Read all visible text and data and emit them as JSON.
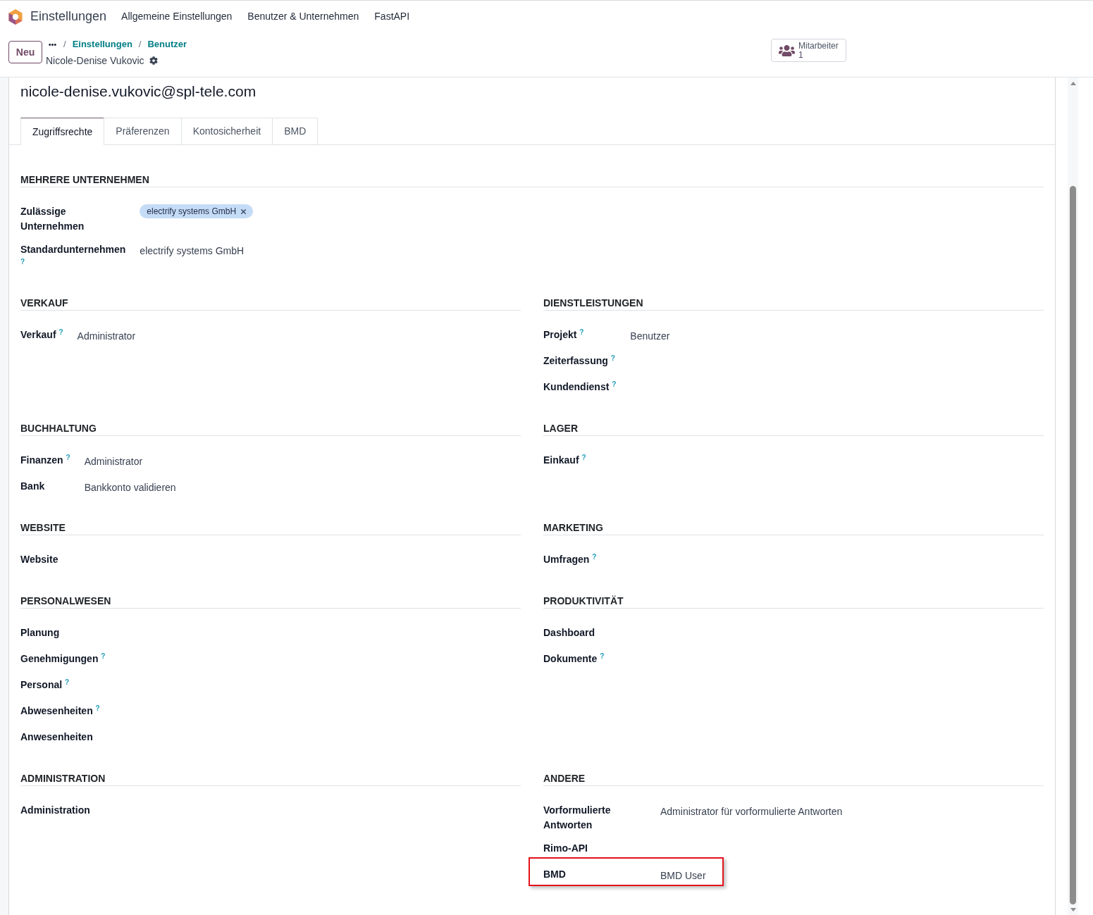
{
  "navbar": {
    "app_name": "Einstellungen",
    "menu": [
      "Allgemeine Einstellungen",
      "Benutzer & Unternehmen",
      "FastAPI"
    ]
  },
  "control_panel": {
    "new_button": "Neu",
    "breadcrumb": {
      "separator": "/",
      "items": [
        "Einstellungen",
        "Benutzer"
      ]
    },
    "record_name": "Nicole-Denise Vukovic",
    "stat_button": {
      "label": "Mitarbeiter",
      "value": "1"
    }
  },
  "form": {
    "title": "nicole-denise.vukovic@spl-tele.com",
    "tabs": [
      {
        "label": "Zugriffsrechte",
        "selected": true
      },
      {
        "label": "Präferenzen",
        "selected": false
      },
      {
        "label": "Kontosicherheit",
        "selected": false
      },
      {
        "label": "BMD",
        "selected": false
      }
    ],
    "multi_company": {
      "heading": "MEHRERE UNTERNEHMEN",
      "rows": [
        {
          "label": "Zulässige Unternehmen",
          "kind": "tags",
          "tags": [
            "electrify systems GmbH"
          ],
          "highlighted": false
        },
        {
          "label": "Standardunternehmen",
          "help": "?",
          "kind": "text",
          "value": "electrify systems GmbH",
          "highlighted": false
        }
      ]
    },
    "sections": [
      {
        "heading": "VERKAUF",
        "rows": [
          {
            "label": "Verkauf",
            "help": "?",
            "value": "Administrator",
            "highlighted": false
          }
        ]
      },
      {
        "heading": "DIENSTLEISTUNGEN",
        "rows": [
          {
            "label": "Projekt",
            "help": "?",
            "value": "Benutzer",
            "highlighted": false
          },
          {
            "label": "Zeiterfassung",
            "help": "?",
            "highlighted": false
          },
          {
            "label": "Kundendienst",
            "help": "?",
            "highlighted": false
          }
        ]
      },
      {
        "heading": "BUCHHALTUNG",
        "rows": [
          {
            "label": "Finanzen",
            "help": "?",
            "value": "Administrator",
            "highlighted": false
          },
          {
            "label": "Bank",
            "value": "Bankkonto validieren",
            "highlighted": false
          }
        ]
      },
      {
        "heading": "LAGER",
        "rows": [
          {
            "label": "Einkauf",
            "help": "?",
            "highlighted": false
          }
        ]
      },
      {
        "heading": "WEBSITE",
        "rows": [
          {
            "label": "Website",
            "highlighted": false
          }
        ]
      },
      {
        "heading": "MARKETING",
        "rows": [
          {
            "label": "Umfragen",
            "help": "?",
            "highlighted": false
          }
        ]
      },
      {
        "heading": "PERSONALWESEN",
        "rows": [
          {
            "label": "Planung",
            "highlighted": false
          },
          {
            "label": "Genehmigungen",
            "help": "?",
            "highlighted": false
          },
          {
            "label": "Personal",
            "help": "?",
            "highlighted": false
          },
          {
            "label": "Abwesenheiten",
            "help": "?",
            "highlighted": false
          },
          {
            "label": "Anwesenheiten",
            "highlighted": false
          }
        ]
      },
      {
        "heading": "PRODUKTIVITÄT",
        "rows": [
          {
            "label": "Dashboard",
            "highlighted": false
          },
          {
            "label": "Dokumente",
            "help": "?",
            "highlighted": false
          }
        ]
      },
      {
        "heading": "ADMINISTRATION",
        "rows": [
          {
            "label": "Administration",
            "highlighted": false
          }
        ]
      },
      {
        "heading": "ANDERE",
        "rows": [
          {
            "label": "Vorformulierte Antworten",
            "value": "Administrator für vorformulierte Antworten",
            "highlighted": false
          },
          {
            "label": "Rimo-API",
            "highlighted": false
          },
          {
            "label": "BMD",
            "value": "BMD User",
            "highlighted": true
          }
        ]
      }
    ]
  }
}
